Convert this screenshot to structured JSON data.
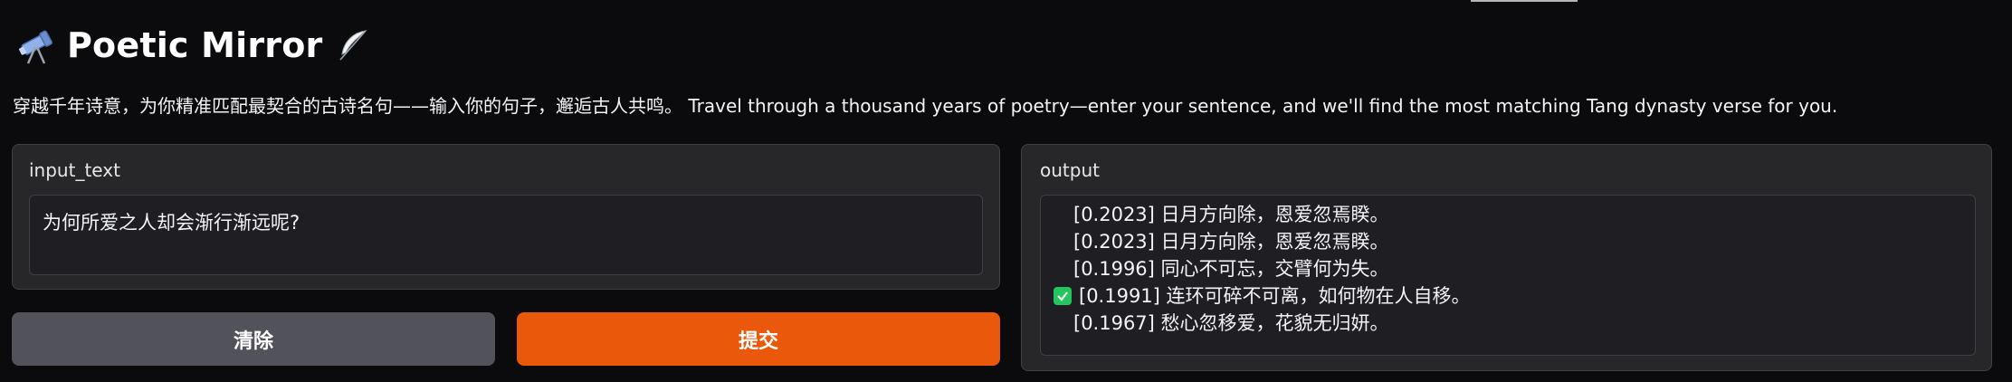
{
  "app": {
    "title": "Poetic Mirror",
    "title_icon": "telescope-icon",
    "title_trailing_icon": "feather-pen-icon",
    "description": "穿越千年诗意，为你精准匹配最契合的古诗名句——输入你的句子，邂逅古人共鸣。 Travel through a thousand years of poetry—enter your sentence, and we'll find the most matching Tang dynasty verse for you."
  },
  "input": {
    "label": "input_text",
    "value": "为何所爱之人却会渐行渐远呢?"
  },
  "output": {
    "label": "output",
    "lines": [
      {
        "text": "[0.2023] 日月方向除，恩爱忽焉睽。",
        "checked": false
      },
      {
        "text": "[0.2023] 日月方向除，恩爱忽焉睽。",
        "checked": false
      },
      {
        "text": "[0.1996] 同心不可忘，交臂何为失。",
        "checked": false
      },
      {
        "text": "[0.1991] 连环可碎不可离，如何物在人自移。",
        "checked": true
      },
      {
        "text": "[0.1967] 愁心忽移爱，花貌无归妍。",
        "checked": false
      }
    ]
  },
  "buttons": {
    "clear_label": "清除",
    "submit_label": "提交"
  },
  "colors": {
    "background": "#0b0b0d",
    "panel": "#27272a",
    "clear_button": "#52525b",
    "submit_button": "#ea580c",
    "check": "#22c55e"
  }
}
